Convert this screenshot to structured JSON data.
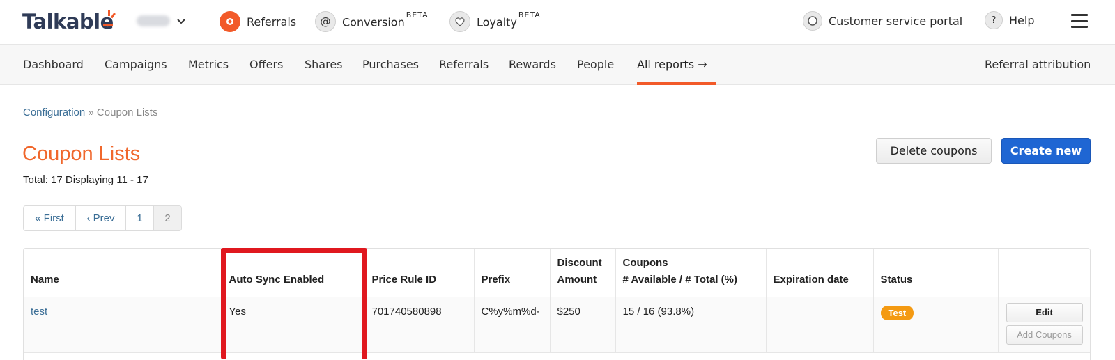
{
  "brand": {
    "logo_text": "Talkable",
    "accent": "#f25a29",
    "title_color": "#f0672c",
    "primary_button": "#1f66d3"
  },
  "header": {
    "site_name": "",
    "products": [
      {
        "label": "Referrals",
        "icon": "referrals-icon",
        "beta": ""
      },
      {
        "label": "Conversion",
        "icon": "at-sign-icon",
        "beta": "BETA"
      },
      {
        "label": "Loyalty",
        "icon": "heart-icon",
        "beta": "BETA"
      }
    ],
    "customer_service": "Customer service portal",
    "help": "Help",
    "help_glyph": "?",
    "at_glyph": "@"
  },
  "subnav": {
    "items": [
      "Dashboard",
      "Campaigns",
      "Metrics",
      "Offers",
      "Shares",
      "Purchases",
      "Referrals",
      "Rewards",
      "People",
      "All reports"
    ],
    "active_arrow": "→",
    "right_link": "Referral attribution"
  },
  "breadcrumb": {
    "parent": "Configuration",
    "separator": "»",
    "current": "Coupon Lists"
  },
  "page": {
    "title": "Coupon Lists",
    "total": "Total: 17 Displaying 11 - 17",
    "delete_button": "Delete coupons",
    "create_button": "Create new"
  },
  "pagination": [
    "« First",
    "‹ Prev",
    "1",
    "2"
  ],
  "table": {
    "headers": {
      "name": "Name",
      "auto_sync": "Auto Sync Enabled",
      "price_rule": "Price Rule ID",
      "prefix": "Prefix",
      "discount_1": "Discount",
      "discount_2": "Amount",
      "coupons_1": "Coupons",
      "coupons_2": "# Available / # Total (%)",
      "expiration": "Expiration date",
      "status": "Status"
    },
    "rows": [
      {
        "name": "test",
        "auto_sync": "Yes",
        "price_rule": "701740580898",
        "prefix": "C%y%m%d-",
        "discount": "$250",
        "coupons": "15 / 16 (93.8%)",
        "expiration": "",
        "status": "Test",
        "edit": "Edit",
        "add_coupons": "Add Coupons"
      }
    ]
  }
}
